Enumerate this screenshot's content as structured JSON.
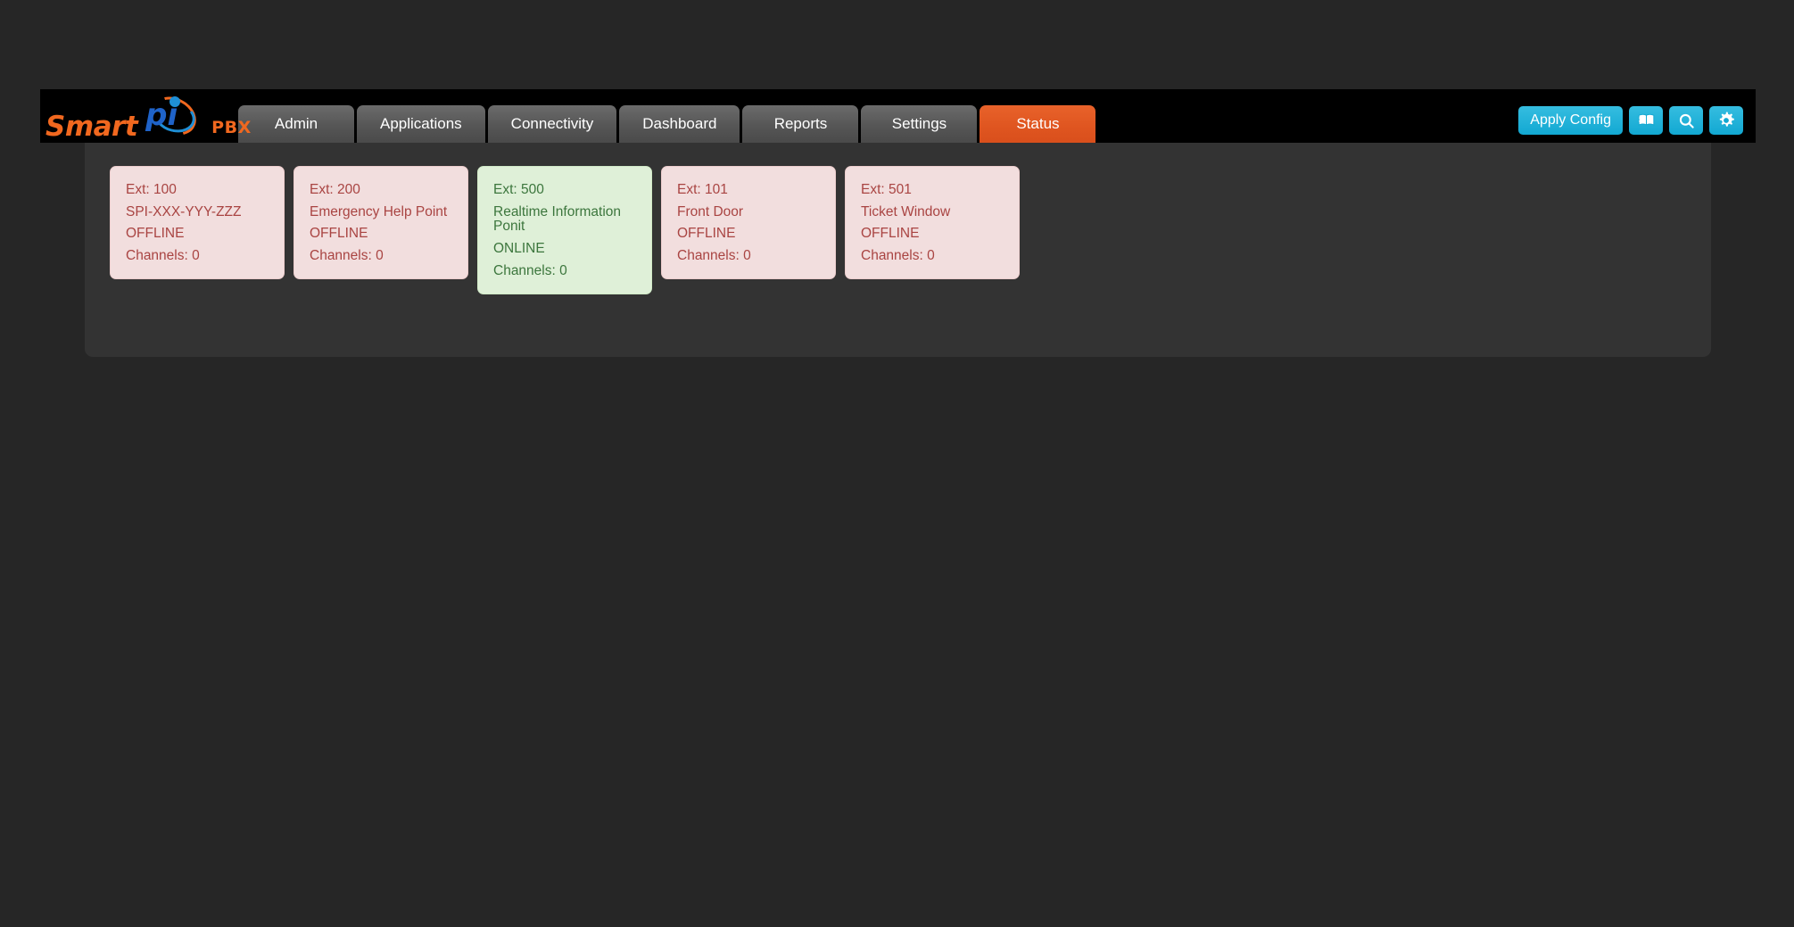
{
  "brand": {
    "smart": "Smart",
    "pi": "pi",
    "suffix": "PBX"
  },
  "nav": {
    "tabs": [
      {
        "label": "Admin",
        "active": false
      },
      {
        "label": "Applications",
        "active": false
      },
      {
        "label": "Connectivity",
        "active": false
      },
      {
        "label": "Dashboard",
        "active": false
      },
      {
        "label": "Reports",
        "active": false
      },
      {
        "label": "Settings",
        "active": false
      },
      {
        "label": "Status",
        "active": true
      }
    ]
  },
  "toolbar": {
    "apply_config_label": "Apply Config",
    "translate_icon": "translate-icon",
    "search_icon": "search-icon",
    "settings_icon": "gear-icon"
  },
  "colors": {
    "page_background": "#262626",
    "panel_background": "#333333",
    "header_background": "#000000",
    "accent_orange": "#df5520",
    "accent_cyan": "#12a8d2",
    "offline_bg": "#f2dede",
    "offline_text": "#a94442",
    "online_bg": "#dff0d8",
    "online_text": "#3c763d"
  },
  "status_cards": [
    {
      "ext": "Ext: 100",
      "name": "SPI-XXX-YYY-ZZZ",
      "state": "OFFLINE",
      "channels": "Channels: 0",
      "status": "offline"
    },
    {
      "ext": "Ext: 200",
      "name": "Emergency Help Point",
      "state": "OFFLINE",
      "channels": "Channels: 0",
      "status": "offline"
    },
    {
      "ext": "Ext: 500",
      "name": "Realtime Information Ponit",
      "state": "ONLINE",
      "channels": "Channels: 0",
      "status": "online"
    },
    {
      "ext": "Ext: 101",
      "name": "Front Door",
      "state": "OFFLINE",
      "channels": "Channels: 0",
      "status": "offline"
    },
    {
      "ext": "Ext: 501",
      "name": "Ticket Window",
      "state": "OFFLINE",
      "channels": "Channels: 0",
      "status": "offline"
    }
  ]
}
